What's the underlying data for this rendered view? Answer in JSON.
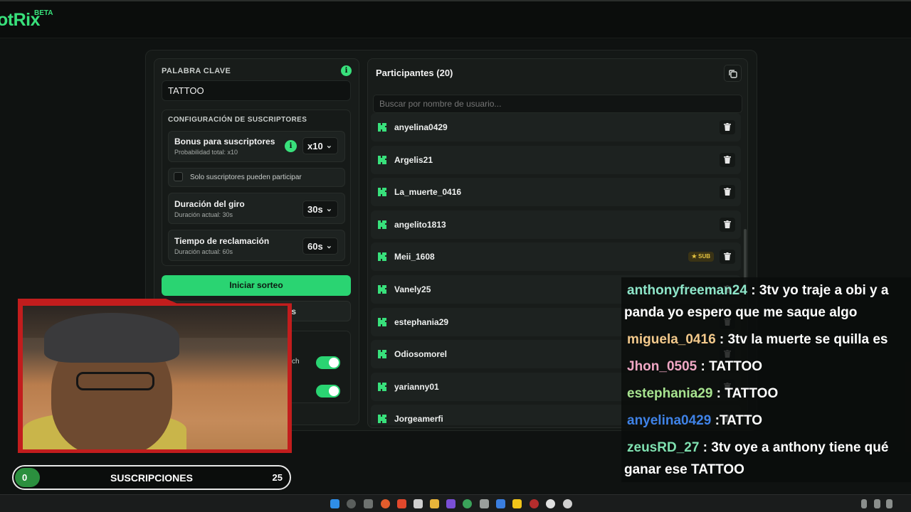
{
  "app": {
    "logo_text": "otRix",
    "beta": "BETA",
    "accent": "#38e07b"
  },
  "left_panel": {
    "keyword_label": "PALABRA CLAVE",
    "keyword_value": "TATTOO",
    "config_title": "CONFIGURACIÓN DE SUSCRIPTORES",
    "bonus": {
      "title": "Bonus para suscriptores",
      "sub": "Probabilidad total: x10",
      "value": "x10"
    },
    "subs_only_label": "Solo suscriptores pueden participar",
    "spin": {
      "title": "Duración del giro",
      "sub": "Duración actual: 30s",
      "value": "30s"
    },
    "claim": {
      "title": "Tiempo de reclamación",
      "sub": "Duración actual: 60s",
      "value": "60s"
    },
    "start_button": "Iniciar sorteo",
    "second_button": "s",
    "toggle1_label": "ch"
  },
  "participants": {
    "title": "Participantes (20)",
    "search_placeholder": "Buscar por nombre de usuario...",
    "items": [
      {
        "name": "anyelina0429",
        "badge": ""
      },
      {
        "name": "Argelis21",
        "badge": ""
      },
      {
        "name": "La_muerte_0416",
        "badge": ""
      },
      {
        "name": "angelito1813",
        "badge": ""
      },
      {
        "name": "Meii_1608",
        "badge": "SUB"
      },
      {
        "name": "Vanely25",
        "badge": ""
      },
      {
        "name": "estephania29",
        "badge": ""
      },
      {
        "name": "Odiosomorel",
        "badge": ""
      },
      {
        "name": "yarianny01",
        "badge": ""
      },
      {
        "name": "Jorgeamerfi",
        "badge": ""
      }
    ]
  },
  "subs_goal": {
    "current": "0",
    "label": "SUSCRIPCIONES",
    "target": "25",
    "progress_fraction": 0
  },
  "chat": [
    {
      "user": "anthonyfreeman24",
      "color": "#8ee6c9",
      "text": " : 3tv yo traje a obi y a",
      "cont": "panda yo espero que me saque algo"
    },
    {
      "user": "miguela_0416",
      "color": "#f3c98b",
      "text": " : 3tv la muerte se quilla es",
      "cont": ""
    },
    {
      "user": "Jhon_0505",
      "color": "#f0a7c4",
      "text": " : TATTOO",
      "cont": ""
    },
    {
      "user": "estephania29",
      "color": "#a7e38f",
      "text": " : TATTOO",
      "cont": ""
    },
    {
      "user": "anyelina0429",
      "color": "#3f82e6",
      "text": " :TATTO",
      "cont": ""
    },
    {
      "user": "zeusRD_27",
      "color": "#7fe0b0",
      "text": " : 3tv oye a anthony tiene qué",
      "cont": "ganar ese TATTOO"
    }
  ]
}
